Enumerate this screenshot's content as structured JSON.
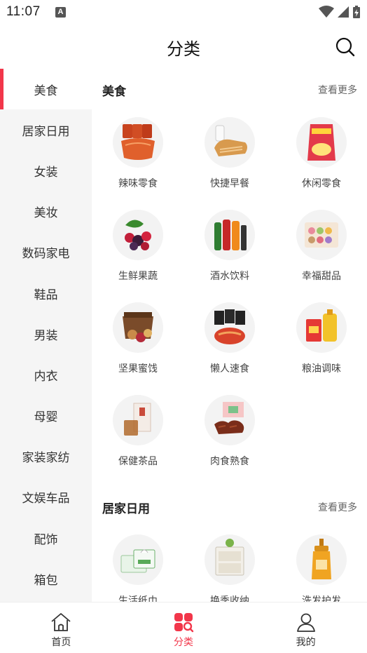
{
  "status_bar": {
    "time": "11:07",
    "notif_glyph": "A"
  },
  "header": {
    "title": "分类"
  },
  "sidebar": {
    "items": [
      {
        "label": "美食"
      },
      {
        "label": "居家日用"
      },
      {
        "label": "女装"
      },
      {
        "label": "美妆"
      },
      {
        "label": "数码家电"
      },
      {
        "label": "鞋品"
      },
      {
        "label": "男装"
      },
      {
        "label": "内衣"
      },
      {
        "label": "母婴"
      },
      {
        "label": "家装家纺"
      },
      {
        "label": "文娱车品"
      },
      {
        "label": "配饰"
      },
      {
        "label": "箱包"
      }
    ],
    "active_index": 0
  },
  "sections": [
    {
      "title": "美食",
      "more": "查看更多",
      "items": [
        {
          "label": "辣味零食",
          "icon": "spicy-snack-image"
        },
        {
          "label": "快捷早餐",
          "icon": "bread-milk-image"
        },
        {
          "label": "休闲零食",
          "icon": "chips-bag-image"
        },
        {
          "label": "生鲜果蔬",
          "icon": "berries-image"
        },
        {
          "label": "酒水饮料",
          "icon": "drink-bottles-image"
        },
        {
          "label": "幸福甜品",
          "icon": "macaron-box-image"
        },
        {
          "label": "坚果蜜饯",
          "icon": "nut-giftbox-image"
        },
        {
          "label": "懒人速食",
          "icon": "instant-noodle-image"
        },
        {
          "label": "粮油调味",
          "icon": "rice-oil-image"
        },
        {
          "label": "保健茶品",
          "icon": "tea-box-image"
        },
        {
          "label": "肉食熟食",
          "icon": "braised-meat-image"
        }
      ]
    },
    {
      "title": "居家日用",
      "more": "查看更多",
      "items": [
        {
          "label": "生活纸巾",
          "icon": "tissue-pack-image"
        },
        {
          "label": "换季收纳",
          "icon": "storage-drawer-image"
        },
        {
          "label": "洗发护发",
          "icon": "shampoo-bottle-image"
        }
      ]
    }
  ],
  "bottom_nav": {
    "items": [
      {
        "label": "首页",
        "icon": "home-icon"
      },
      {
        "label": "分类",
        "icon": "category-icon"
      },
      {
        "label": "我的",
        "icon": "user-icon"
      }
    ],
    "active_index": 1
  },
  "colors": {
    "accent": "#f2364a",
    "sidebar_bg": "#f5f5f5",
    "text": "#333333"
  }
}
